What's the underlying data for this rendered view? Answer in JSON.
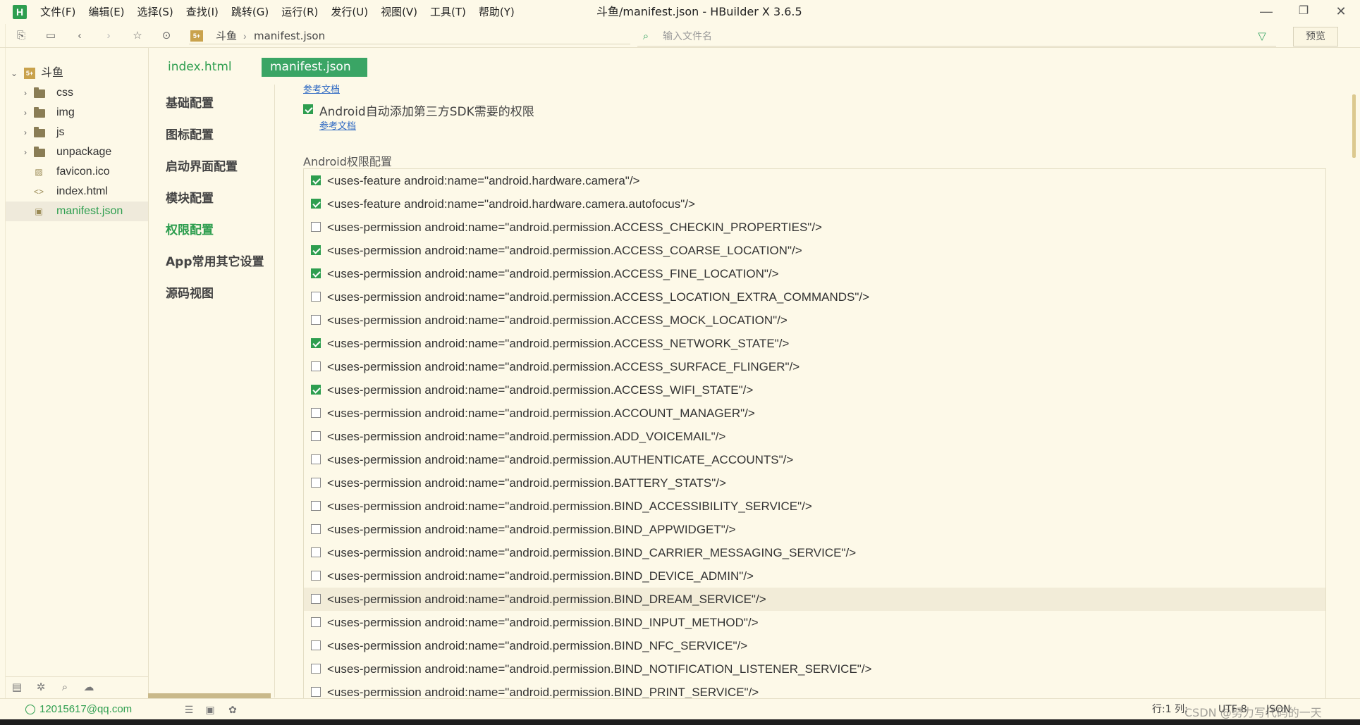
{
  "app": {
    "logo": "H",
    "window_title": "斗鱼/manifest.json - HBuilder X 3.6.5"
  },
  "menu": [
    "文件(F)",
    "编辑(E)",
    "选择(S)",
    "查找(I)",
    "跳转(G)",
    "运行(R)",
    "发行(U)",
    "视图(V)",
    "工具(T)",
    "帮助(Y)"
  ],
  "window_controls": {
    "minimize": "—",
    "restore": "❐",
    "close": "✕"
  },
  "toolbar": {
    "breadcrumb": [
      "斗鱼",
      "manifest.json"
    ],
    "search_placeholder": "输入文件名",
    "preview_label": "预览"
  },
  "project_tree": {
    "root": "斗鱼",
    "root_icon": "5+",
    "items": [
      {
        "label": "css",
        "type": "folder"
      },
      {
        "label": "img",
        "type": "folder"
      },
      {
        "label": "js",
        "type": "folder"
      },
      {
        "label": "unpackage",
        "type": "folder"
      },
      {
        "label": "favicon.ico",
        "type": "image"
      },
      {
        "label": "index.html",
        "type": "html"
      },
      {
        "label": "manifest.json",
        "type": "json",
        "selected": true
      }
    ]
  },
  "tabs": [
    {
      "label": "index.html",
      "active": false
    },
    {
      "label": "manifest.json",
      "active": true
    }
  ],
  "manifest_nav": [
    {
      "label": "基础配置",
      "active": false
    },
    {
      "label": "图标配置",
      "active": false
    },
    {
      "label": "启动界面配置",
      "active": false
    },
    {
      "label": "模块配置",
      "active": false
    },
    {
      "label": "权限配置",
      "active": true
    },
    {
      "label": "App常用其它设置",
      "active": false
    },
    {
      "label": "源码视图",
      "active": false
    }
  ],
  "content": {
    "doc_link_top": "参考文档",
    "auto_sdk_permission_label": "Android自动添加第三方SDK需要的权限",
    "auto_sdk_permission_checked": true,
    "doc_link_sdk": "参考文档",
    "section_title": "Android权限配置",
    "permissions": [
      {
        "text": "<uses-feature android:name=\"android.hardware.camera\"/>",
        "checked": true
      },
      {
        "text": "<uses-feature android:name=\"android.hardware.camera.autofocus\"/>",
        "checked": true
      },
      {
        "text": "<uses-permission android:name=\"android.permission.ACCESS_CHECKIN_PROPERTIES\"/>",
        "checked": false
      },
      {
        "text": "<uses-permission android:name=\"android.permission.ACCESS_COARSE_LOCATION\"/>",
        "checked": true
      },
      {
        "text": "<uses-permission android:name=\"android.permission.ACCESS_FINE_LOCATION\"/>",
        "checked": true
      },
      {
        "text": "<uses-permission android:name=\"android.permission.ACCESS_LOCATION_EXTRA_COMMANDS\"/>",
        "checked": false
      },
      {
        "text": "<uses-permission android:name=\"android.permission.ACCESS_MOCK_LOCATION\"/>",
        "checked": false
      },
      {
        "text": "<uses-permission android:name=\"android.permission.ACCESS_NETWORK_STATE\"/>",
        "checked": true
      },
      {
        "text": "<uses-permission android:name=\"android.permission.ACCESS_SURFACE_FLINGER\"/>",
        "checked": false
      },
      {
        "text": "<uses-permission android:name=\"android.permission.ACCESS_WIFI_STATE\"/>",
        "checked": true
      },
      {
        "text": "<uses-permission android:name=\"android.permission.ACCOUNT_MANAGER\"/>",
        "checked": false
      },
      {
        "text": "<uses-permission android:name=\"android.permission.ADD_VOICEMAIL\"/>",
        "checked": false
      },
      {
        "text": "<uses-permission android:name=\"android.permission.AUTHENTICATE_ACCOUNTS\"/>",
        "checked": false
      },
      {
        "text": "<uses-permission android:name=\"android.permission.BATTERY_STATS\"/>",
        "checked": false
      },
      {
        "text": "<uses-permission android:name=\"android.permission.BIND_ACCESSIBILITY_SERVICE\"/>",
        "checked": false
      },
      {
        "text": "<uses-permission android:name=\"android.permission.BIND_APPWIDGET\"/>",
        "checked": false
      },
      {
        "text": "<uses-permission android:name=\"android.permission.BIND_CARRIER_MESSAGING_SERVICE\"/>",
        "checked": false
      },
      {
        "text": "<uses-permission android:name=\"android.permission.BIND_DEVICE_ADMIN\"/>",
        "checked": false
      },
      {
        "text": "<uses-permission android:name=\"android.permission.BIND_DREAM_SERVICE\"/>",
        "checked": false,
        "hover": true
      },
      {
        "text": "<uses-permission android:name=\"android.permission.BIND_INPUT_METHOD\"/>",
        "checked": false
      },
      {
        "text": "<uses-permission android:name=\"android.permission.BIND_NFC_SERVICE\"/>",
        "checked": false
      },
      {
        "text": "<uses-permission android:name=\"android.permission.BIND_NOTIFICATION_LISTENER_SERVICE\"/>",
        "checked": false
      },
      {
        "text": "<uses-permission android:name=\"android.permission.BIND_PRINT_SERVICE\"/>",
        "checked": false
      }
    ]
  },
  "statusbar": {
    "user": "12015617@qq.com",
    "line_col": "行:1  列:",
    "encoding": "UTF-8",
    "language": "JSON"
  },
  "watermark": "CSDN @努力写代码的一天",
  "colors": {
    "accent": "#2e9e4f",
    "background": "#fdf9e8",
    "link": "#2a66c2"
  }
}
